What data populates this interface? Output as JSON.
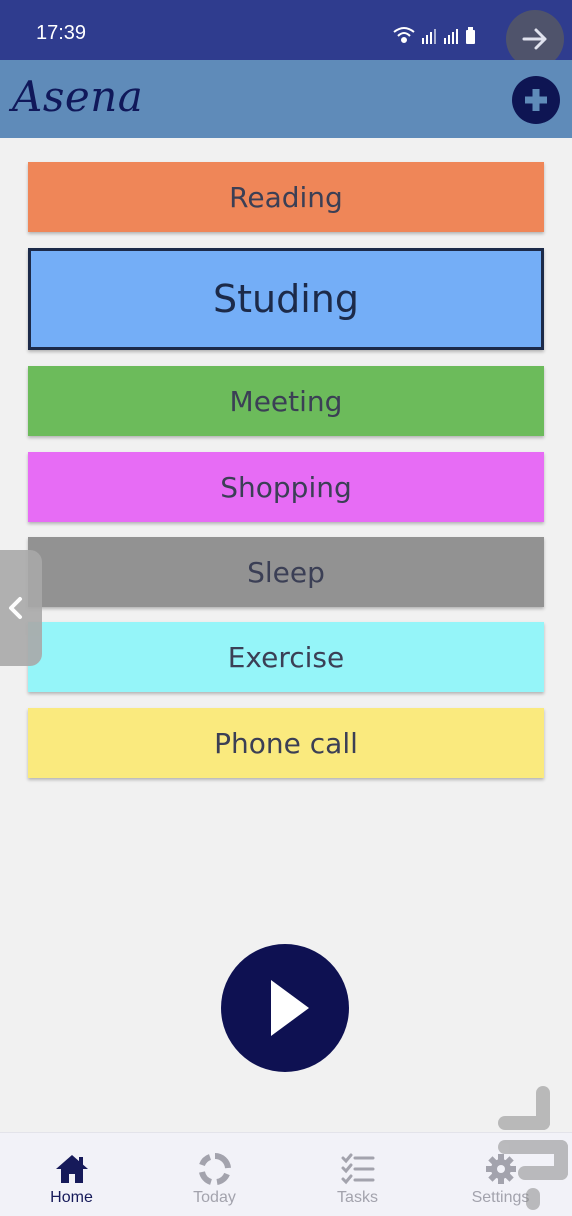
{
  "status_bar": {
    "time": "17:39",
    "icons": [
      "wifi-icon",
      "signal-icon",
      "signal-icon",
      "battery-icon"
    ],
    "forward_icon": "arrow-right-icon"
  },
  "header": {
    "title": "Asena",
    "add_icon": "plus-icon",
    "background": "#5f8bb9"
  },
  "activities": [
    {
      "label": "Reading",
      "color": "#ef8658"
    },
    {
      "label": "Studing",
      "color": "#74aef7",
      "selected": true
    },
    {
      "label": "Meeting",
      "color": "#6cbb5b"
    },
    {
      "label": "Shopping",
      "color": "#e76cf5"
    },
    {
      "label": "Sleep",
      "color": "#929292"
    },
    {
      "label": "Exercise",
      "color": "#95f5f9"
    },
    {
      "label": "Phone call",
      "color": "#faea7e"
    }
  ],
  "side_tab_icon": "chevron-left-icon",
  "play_icon": "play-icon",
  "nav": {
    "items": [
      {
        "label": "Home",
        "icon": "home-icon",
        "active": true
      },
      {
        "label": "Today",
        "icon": "progress-ring-icon"
      },
      {
        "label": "Tasks",
        "icon": "checklist-icon"
      },
      {
        "label": "Settings",
        "icon": "gear-icon"
      }
    ]
  },
  "colors": {
    "status_bar": "#2f3c8e",
    "navy": "#0e1553",
    "background": "#f1f1f1"
  }
}
